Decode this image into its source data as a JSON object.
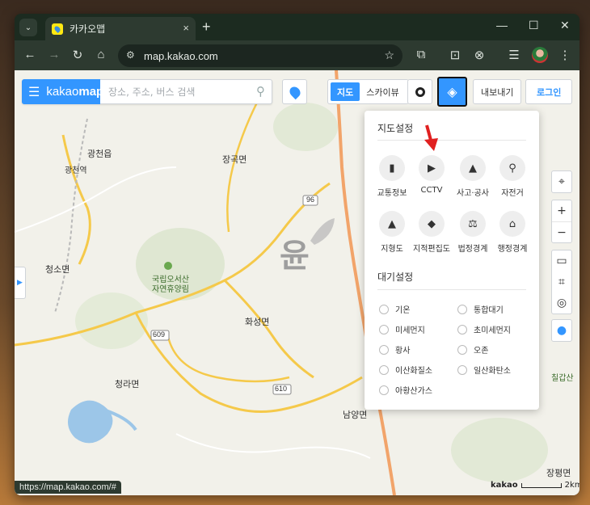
{
  "browser": {
    "tab_title": "카카오맵",
    "tab_close": "×",
    "new_tab": "+",
    "url": "map.kakao.com",
    "status_url": "https://map.kakao.com/#",
    "controls": {
      "minimize": "—",
      "maximize": "☐",
      "close": "✕"
    },
    "menu": "⌄"
  },
  "header": {
    "logo_prefix": "kakao",
    "logo_suffix": "map",
    "search_placeholder": "장소, 주소, 버스 검색",
    "map_tab": "지도",
    "skyview_tab": "스카이뷰",
    "export_label": "내보내기",
    "login_label": "로그인"
  },
  "layer_panel": {
    "map_settings_title": "지도설정",
    "map_settings": [
      {
        "label": "교통정보",
        "icon": "traffic-light-icon"
      },
      {
        "label": "CCTV",
        "icon": "cctv-icon"
      },
      {
        "label": "사고·공사",
        "icon": "warning-icon"
      },
      {
        "label": "자전거",
        "icon": "bicycle-icon"
      },
      {
        "label": "지형도",
        "icon": "terrain-icon"
      },
      {
        "label": "지적편집도",
        "icon": "cadastral-icon"
      },
      {
        "label": "법정경계",
        "icon": "scale-icon"
      },
      {
        "label": "행정경계",
        "icon": "government-icon"
      }
    ],
    "air_settings_title": "대기설정",
    "air_settings": [
      "기온",
      "통합대기",
      "미세먼지",
      "초미세먼지",
      "황사",
      "오존",
      "이산화질소",
      "일산화탄소",
      "아황산가스"
    ]
  },
  "map": {
    "labels": [
      "광천읍",
      "광천역",
      "장곡면",
      "청소면",
      "국립오서산",
      "자연휴양림",
      "화성면",
      "청라면",
      "남양면",
      "칠갑산",
      "장평면"
    ],
    "road_numbers": [
      "96",
      "609",
      "610"
    ]
  },
  "scale": {
    "brand": "kakao",
    "distance": "2km"
  }
}
